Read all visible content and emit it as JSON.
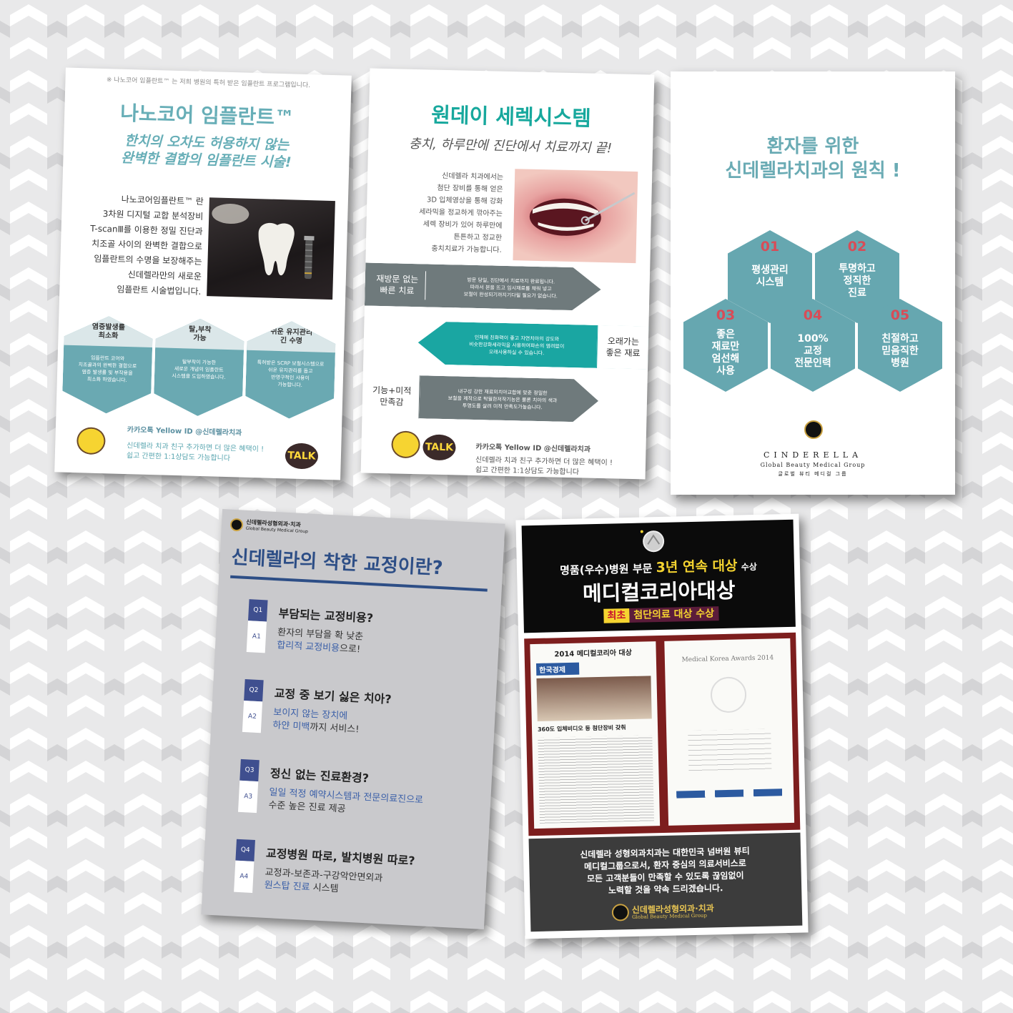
{
  "colors": {
    "teal": "#67aeb7",
    "green_teal": "#17a89d",
    "gray_band": "#6f7a7c",
    "navy": "#2d4e86",
    "award_yellow": "#f5d430",
    "background": "#e9e9ea"
  },
  "implant_poster": {
    "note": "※ 나노코어 임플란트™ 는 저희 병원의 특허 받은 임플란트 프로그램입니다.",
    "title": "나노코어 임플란트™",
    "subtitle_line1": "한치의 오차도 허용하지 않는",
    "subtitle_line2": "완벽한 결합의 임플란트 시술!",
    "body_lines": [
      "나노코어임플란트™ 란",
      "3차원 디지털 교합 분석장비",
      "T-scanⅢ를 이용한 정밀 진단과",
      "치조골 사이의 완벽한 결합으로",
      "임플란트의 수명을 보장해주는",
      "신데렐라만의 새로운",
      "임플란트 시술법입니다."
    ],
    "features": [
      {
        "label_line1": "염증발생률",
        "label_line2": "최소화",
        "body_line1": "임플란트 코어와",
        "body_line2": "치조골과의 완벽한 결합으로",
        "body_line3": "염증 발생률 및 부작용을",
        "body_line4": "최소화 하였습니다."
      },
      {
        "label_line1": "탈,부착",
        "label_line2": "가능",
        "body_line1": "탈부착이 가능한",
        "body_line2": "새로운 개념의 임플란트",
        "body_line3": "시스템을 도입하였습니다.",
        "body_line4": ""
      },
      {
        "label_line1": "쉬운 유지관리",
        "label_line2": "긴 수명",
        "body_line1": "특허받은 SCRP 보철시스템으로",
        "body_line2": "쉬운 유지관리를 돕고",
        "body_line3": "반영구적인 사용이",
        "body_line4": "가능합니다."
      }
    ],
    "kakao_id": "카카오톡   Yellow ID @신데렐라치과",
    "kakao_line1": "신데렐라  치과  친구  추가하면   더  많은  혜택이 !",
    "kakao_line2": "쉽고  간편한   1:1상담도   가능합니다",
    "talk_label": "TALK"
  },
  "oneday_poster": {
    "title": "원데이 세렉시스템",
    "subtitle": "충치, 하루만에 진단에서 치료까지 끝!",
    "body_lines": [
      "신데렐라 치과에서는",
      "첨단 장비를 통해 얻은",
      "3D 입체영상을 통해 강화",
      "세라믹을 정교하게 깎아주는",
      "세렉 장비가 있어 하루만에",
      "튼튼하고 정교한",
      "충치치료가 가능합니다."
    ],
    "bands": [
      {
        "label_line1": "재방문 없는",
        "label_line2": "빠른 치료",
        "text_line1": "방문 당일, 진단에서 치료까지 완료됩니다.",
        "text_line2": "따라서 본을 뜨고 임시재료를 채워 넣고",
        "text_line3": "보철이 완성되기까지기다릴 필요가 없습니다."
      },
      {
        "label_line1": "오래가는",
        "label_line2": "좋은 재료",
        "text_line1": "인체에 친화력이 좋고 자연치아의 강도와",
        "text_line2": "비슷한강화세라믹을 사용하여파손의 염려없이",
        "text_line3": "오래사용하실 수 있습니다."
      },
      {
        "label_line1": "기능+미적",
        "label_line2": "만족감",
        "text_line1": "내구성 강한 재료외치아교합에 맞춘 정밀한",
        "text_line2": "보철을 제작으로 탁월한저작기능은 물론 치아의 색과",
        "text_line3": "투명도를 살려 미적 만족도가높습니다."
      }
    ],
    "kakao_id": "카카오톡   Yellow ID @신데렐라치과",
    "kakao_line1": "신데렐라  치과  친구  추가하면   더  많은  혜택이 !",
    "kakao_line2": "쉽고  간편한   1:1상담도   가능합니다",
    "talk_label": "TALK"
  },
  "principle_poster": {
    "title_line1": "환자를 위한",
    "title_line2": "신데렐라치과의  원칙 !",
    "items": [
      {
        "num": "01",
        "line1": "평생관리",
        "line2": "시스템",
        "line3": "",
        "line4": ""
      },
      {
        "num": "02",
        "line1": "투명하고",
        "line2": "정직한",
        "line3": "진료",
        "line4": ""
      },
      {
        "num": "03",
        "line1": "좋은",
        "line2": "재료만",
        "line3": "엄선해",
        "line4": "사용"
      },
      {
        "num": "04",
        "line1": "100%",
        "line2": "교정",
        "line3": "전문인력",
        "line4": ""
      },
      {
        "num": "05",
        "line1": "친절하고",
        "line2": "믿음직한",
        "line3": "병원",
        "line4": ""
      }
    ],
    "brand_name": "CINDERELLA",
    "brand_sub": "Global Beauty Medical Group",
    "brand_kr": "글로벌 뷰티 메디컬 그룹"
  },
  "ortho_poster": {
    "brand_line1": "신데렐라성형외과·치과",
    "brand_line2": "Global Beauty Medical Group",
    "title": "신데렐라의 착한 교정이란?",
    "qa": [
      {
        "q_tag": "Q1",
        "a_tag": "A1",
        "question": "부담되는 교정비용?",
        "answer_line1": "환자의 부담을 확 낮춘",
        "answer_line2_hl": "합리적 교정비용",
        "answer_line2_rest": "으로!"
      },
      {
        "q_tag": "Q2",
        "a_tag": "A2",
        "question": "교정 중 보기 싫은 치아?",
        "answer_line1": "보이지 않는 장치에",
        "answer_line2_hl": "하얀 미백",
        "answer_line2_rest": "까지 서비스!"
      },
      {
        "q_tag": "Q3",
        "a_tag": "A3",
        "question": "정신 없는 진료환경?",
        "answer_line1": "일일 적정 예약시스템과 전문의료진으로",
        "answer_line2_hl": "",
        "answer_line2_rest": "수준 높은 진료 제공"
      },
      {
        "q_tag": "Q4",
        "a_tag": "A4",
        "question": "교정병원 따로, 발치병원 따로?",
        "answer_line1": "교정과-보존과-구강악안면외과",
        "answer_line2_hl": "원스탑 진료",
        "answer_line2_rest": " 시스템"
      }
    ]
  },
  "award_poster": {
    "line1_pre": "명품(우수)병원 부문",
    "line1_highlight": "3년 연속 대상",
    "line1_post": "수상",
    "line2": "메디컬코리아대상",
    "badge_first": "최초",
    "badge_rest": "첨단의료 대상 수상",
    "doc_left_title": "2014 메디컬코리아 대상",
    "doc_left_paper": "한국경제",
    "doc_left_headline": "360도 입체비디오 등 첨단장비 갖춰",
    "doc_right_title": "Medical Korea Awards 2014",
    "footer_line1": "신데렐라 성형외과치과는 대한민국 넘버원 뷰티",
    "footer_line2": "메디컬그룹으로서, 환자 중심의 의료서비스로",
    "footer_line3": "모든 고객분들이 만족할 수 있도록 끊임없이",
    "footer_line4": "노력할 것을 약속 드리겠습니다.",
    "footer_brand": "신데렐라성형외과·치과",
    "footer_brand_sub": "Global Beauty Medical Group"
  }
}
